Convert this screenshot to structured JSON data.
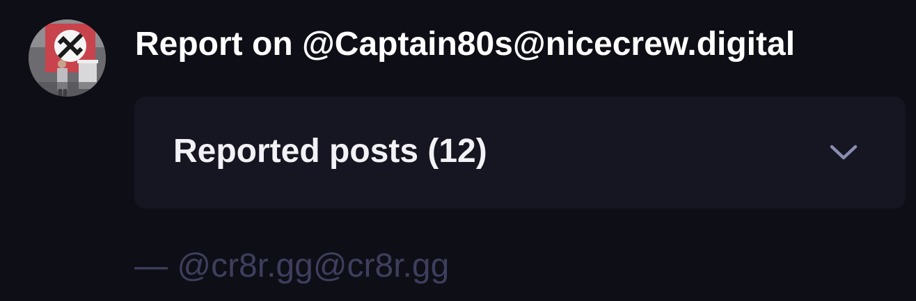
{
  "report": {
    "title": "Report on @Captain80s@nicecrew.digital",
    "avatar_icon": "user-avatar",
    "reported_posts": {
      "label": "Reported posts (12)",
      "expanded": false,
      "toggle_icon": "chevron-down-icon"
    },
    "reporter": {
      "prefix": "—",
      "handle": "@cr8r.gg@cr8r.gg"
    }
  },
  "colors": {
    "background": "#0e0e16",
    "panel": "#161622",
    "title_text": "#ffffff",
    "muted_text": "#3e3f5e",
    "chevron": "#8a8cb0"
  }
}
